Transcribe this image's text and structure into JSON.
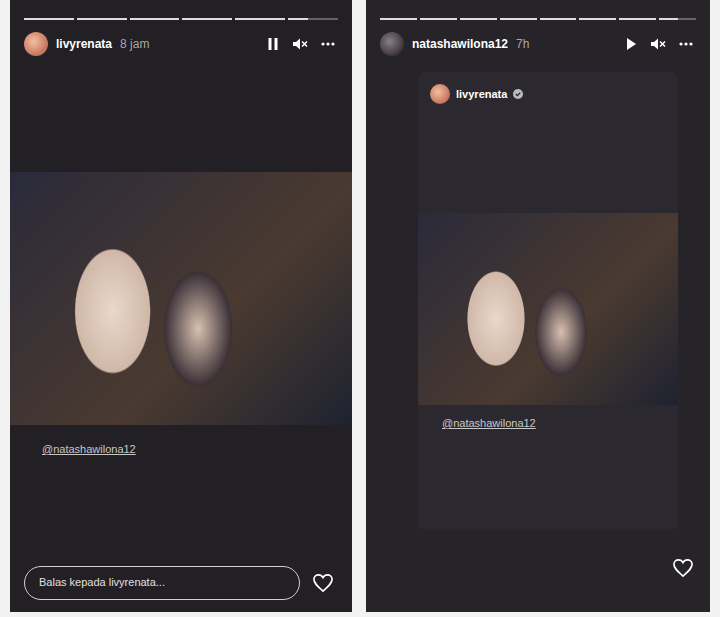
{
  "stories": [
    {
      "username": "livyrenata",
      "time": "8 jam",
      "paused": false,
      "muted": true,
      "segments": [
        {
          "level": 1
        },
        {
          "level": 1
        },
        {
          "level": 1
        },
        {
          "level": 1
        },
        {
          "level": 1
        },
        {
          "level": 0.4
        }
      ],
      "mention": "@natashawilona12",
      "reply_placeholder": "Balas kepada livyrenata..."
    },
    {
      "username": "natashawilona12",
      "time": "7h",
      "paused": true,
      "muted": true,
      "segments": [
        {
          "level": 1
        },
        {
          "level": 1
        },
        {
          "level": 1
        },
        {
          "level": 1
        },
        {
          "level": 1
        },
        {
          "level": 1
        },
        {
          "level": 1
        },
        {
          "level": 0.5
        }
      ],
      "shared_post": {
        "username": "livyrenata",
        "verified": true,
        "mention": "@natashawilona12"
      }
    }
  ]
}
